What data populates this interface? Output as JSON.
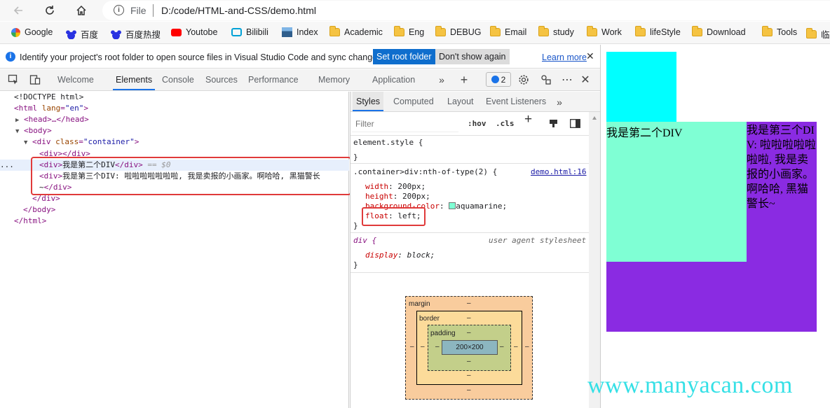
{
  "browser": {
    "url_scheme": "File",
    "url_path": "D:/code/HTML-and-CSS/demo.html",
    "bookmarks": [
      {
        "label": "Google",
        "icon": "google-icon"
      },
      {
        "label": "百度",
        "icon": "baidu-icon"
      },
      {
        "label": "百度热搜",
        "icon": "baidu-icon"
      },
      {
        "label": "Youtobe",
        "icon": "youtube-icon"
      },
      {
        "label": "Bilibili",
        "icon": "bilibili-icon"
      },
      {
        "label": "Index",
        "icon": "avatar-icon"
      },
      {
        "label": "Academic",
        "icon": "folder-icon"
      },
      {
        "label": "Eng",
        "icon": "folder-icon"
      },
      {
        "label": "DEBUG",
        "icon": "folder-icon"
      },
      {
        "label": "Email",
        "icon": "folder-icon"
      },
      {
        "label": "study",
        "icon": "folder-icon"
      },
      {
        "label": "Work",
        "icon": "folder-icon"
      },
      {
        "label": "lifeStyle",
        "icon": "folder-icon"
      },
      {
        "label": "Download",
        "icon": "folder-icon"
      },
      {
        "label": "Tools",
        "icon": "folder-icon"
      },
      {
        "label": "临",
        "icon": "folder-icon"
      }
    ]
  },
  "infobar": {
    "message": "Identify your project's root folder to open source files in Visual Studio Code and sync changes.",
    "set_root": "Set root folder",
    "dont_show": "Don't show again",
    "learn_more": "Learn more",
    "close": "✕"
  },
  "devtools": {
    "tabs": [
      "Welcome",
      "Elements",
      "Console",
      "Sources",
      "Performance",
      "Memory",
      "Application"
    ],
    "active_tab": "Elements",
    "issues_count": "2",
    "dom": {
      "doctype": "<!DOCTYPE html>",
      "html_open_tag": "html",
      "html_attr": "lang",
      "html_attr_val": "\"en\"",
      "head": "<head>…</head>",
      "body_open": "<body>",
      "container_tag": "div",
      "container_attr": "class",
      "container_val": "\"container\"",
      "div_empty": "<div></div>",
      "div2_open": "<div>",
      "div2_text": "我是第二个DIV",
      "div2_close": "</div>",
      "selected_marker": "== $0",
      "div3_open": "<div>",
      "div3_text": "我是第三个DIV: 啦啦啦啦啦啦啦, 我是卖报的小画家。啊哈哈, 黑猫警长",
      "div3_text_2": "~",
      "div3_close": "</div>",
      "div_close": "</div>",
      "body_close": "</body>",
      "html_close": "</html>",
      "ellipsis": "..."
    },
    "styles": {
      "tabs": [
        "Styles",
        "Computed",
        "Layout",
        "Event Listeners"
      ],
      "active_tab": "Styles",
      "filter_placeholder": "Filter",
      "hov": ":hov",
      "cls": ".cls",
      "element_style": "element.style {",
      "close_brace": "}",
      "rule1_selector": ".container>div:nth-of-type(2) {",
      "rule1_source": "demo.html:16",
      "rule1": [
        {
          "prop": "width",
          "value": "200px;"
        },
        {
          "prop": "height",
          "value": "200px;"
        },
        {
          "prop": "background-color",
          "value": "aquamarine;",
          "swatch": "#7fffd4"
        },
        {
          "prop": "float",
          "value": "left;"
        }
      ],
      "rule2_selector": "div {",
      "rule2_source": "user agent stylesheet",
      "rule2": [
        {
          "prop": "display",
          "value": "block;"
        }
      ]
    },
    "box_model": {
      "margin_label": "margin",
      "border_label": "border",
      "padding_label": "padding",
      "content": "200×200",
      "dash": "–"
    }
  },
  "preview": {
    "div2_text": "我是第二个DIV",
    "div3_text": "我是第三个DIV: 啦啦啦啦啦啦啦, 我是卖报的小画家。啊哈哈, 黑猫警长~",
    "colors": {
      "div1": "#00ffff",
      "div2": "#7fffd4",
      "div3": "#8a2be2"
    }
  },
  "watermark": "www.manyacan.com"
}
